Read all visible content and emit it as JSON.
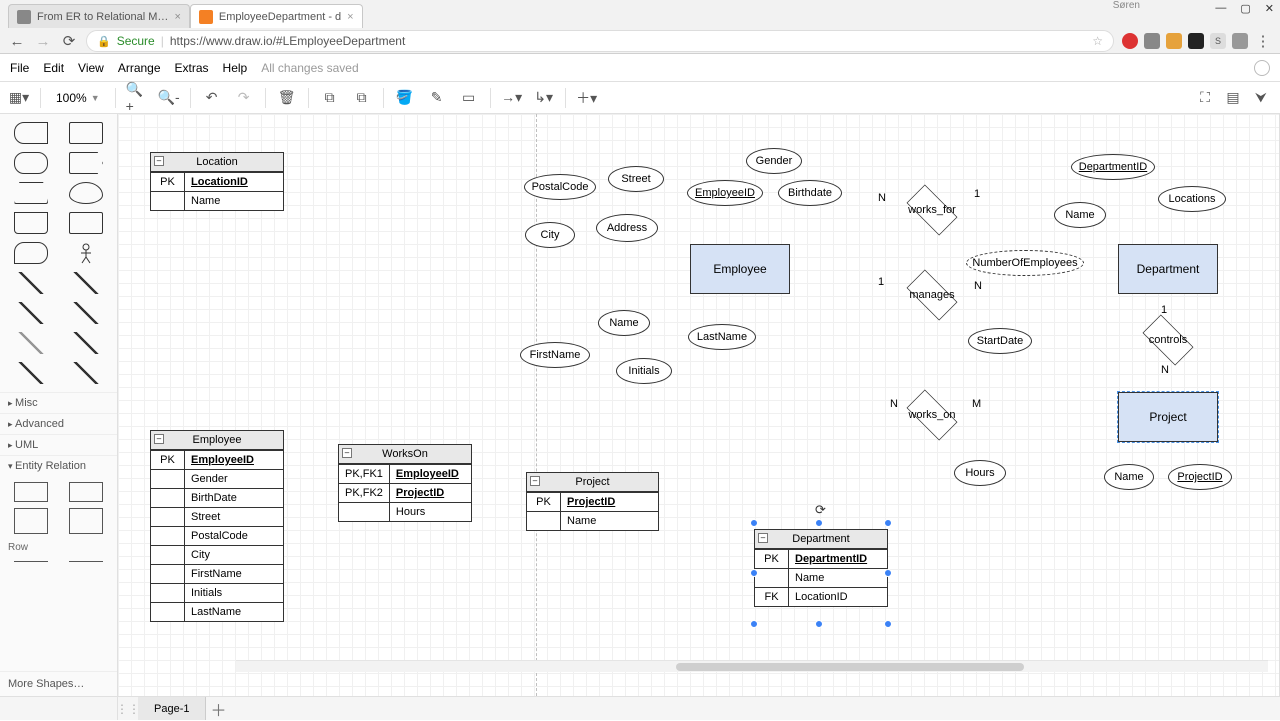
{
  "browser": {
    "tabs": [
      {
        "title": "From ER to Relational M…",
        "active": false
      },
      {
        "title": "EmployeeDepartment - d",
        "active": true
      }
    ],
    "secure_label": "Secure",
    "url": "https://www.draw.io/#LEmployeeDepartment",
    "window_user": "Søren"
  },
  "menus": [
    "File",
    "Edit",
    "View",
    "Arrange",
    "Extras",
    "Help"
  ],
  "save_status": "All changes saved",
  "zoom": "100%",
  "sidebar": {
    "sections": [
      "Misc",
      "Advanced",
      "UML",
      "Entity Relation"
    ],
    "row_label": "Row",
    "more": "More Shapes…"
  },
  "pages": [
    "Page-1"
  ],
  "tables": {
    "location": {
      "title": "Location",
      "rows": [
        {
          "k": "PK",
          "n": "LocationID",
          "u": true,
          "b": true
        },
        {
          "k": "",
          "n": "Name"
        }
      ]
    },
    "employee": {
      "title": "Employee",
      "rows": [
        {
          "k": "PK",
          "n": "EmployeeID",
          "u": true,
          "b": true
        },
        {
          "k": "",
          "n": "Gender"
        },
        {
          "k": "",
          "n": "BirthDate"
        },
        {
          "k": "",
          "n": "Street"
        },
        {
          "k": "",
          "n": "PostalCode"
        },
        {
          "k": "",
          "n": "City"
        },
        {
          "k": "",
          "n": "FirstName"
        },
        {
          "k": "",
          "n": "Initials"
        },
        {
          "k": "",
          "n": "LastName"
        }
      ]
    },
    "workson": {
      "title": "WorksOn",
      "rows": [
        {
          "k": "PK,FK1",
          "n": "EmployeeID",
          "u": true,
          "b": true
        },
        {
          "k": "PK,FK2",
          "n": "ProjectID",
          "u": true,
          "b": true
        },
        {
          "k": "",
          "n": "Hours"
        }
      ]
    },
    "project": {
      "title": "Project",
      "rows": [
        {
          "k": "PK",
          "n": "ProjectID",
          "u": true,
          "b": true
        },
        {
          "k": "",
          "n": "Name"
        }
      ]
    },
    "department": {
      "title": "Department",
      "rows": [
        {
          "k": "PK",
          "n": "DepartmentID",
          "u": true,
          "b": true
        },
        {
          "k": "",
          "n": "Name"
        },
        {
          "k": "FK",
          "n": "LocationID"
        }
      ]
    }
  },
  "er": {
    "entities": {
      "employee": "Employee",
      "department": "Department",
      "project": "Project"
    },
    "attributes": {
      "postalcode": "PostalCode",
      "street": "Street",
      "city": "City",
      "address": "Address",
      "employeeid": "EmployeeID",
      "gender": "Gender",
      "birthdate": "Birthdate",
      "name_emp": "Name",
      "firstname": "FirstName",
      "lastname": "LastName",
      "initials": "Initials",
      "dept_id": "DepartmentID",
      "locations": "Locations",
      "name_dept": "Name",
      "num_emp": "NumberOfEmployees",
      "startdate": "StartDate",
      "hours": "Hours",
      "name_proj": "Name",
      "projectid": "ProjectID"
    },
    "relations": {
      "works_for": "works_for",
      "manages": "manages",
      "works_on": "works_on",
      "controls": "controls"
    },
    "card": {
      "wf_n": "N",
      "wf_1": "1",
      "mg_1": "1",
      "mg_n": "N",
      "wo_n": "N",
      "wo_m": "M",
      "ct_1": "1",
      "ct_n": "N"
    }
  }
}
